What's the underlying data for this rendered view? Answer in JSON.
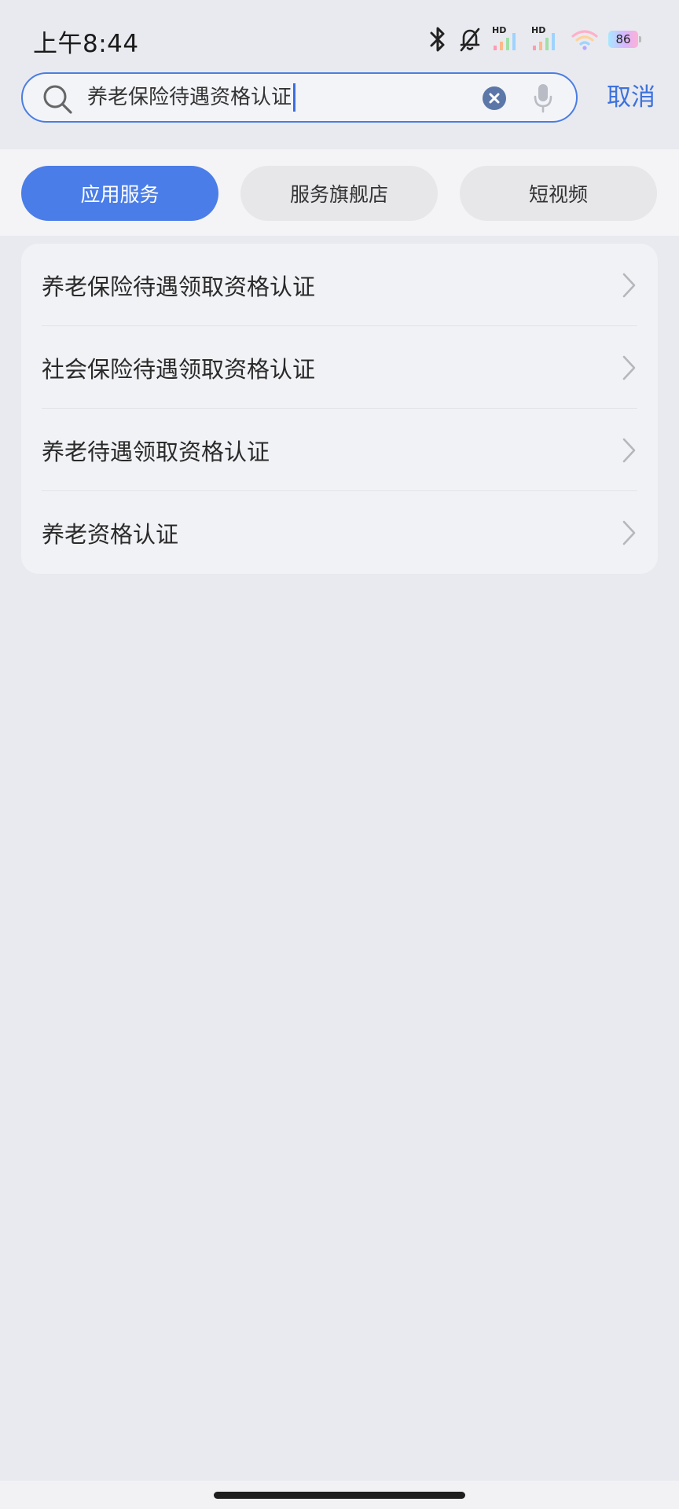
{
  "status_bar": {
    "time": "上午8:44",
    "signal_1_label": "HD",
    "signal_2_label": "HD",
    "battery": "86",
    "icons": [
      "bluetooth-icon",
      "mute-bell-icon",
      "signal-icon",
      "signal-icon",
      "wifi-icon",
      "battery-icon"
    ]
  },
  "search": {
    "query": "养老保险待遇资格认证",
    "cancel_label": "取消",
    "accent_color": "#4a7de3"
  },
  "tabs": [
    {
      "label": "应用服务",
      "active": true
    },
    {
      "label": "服务旗舰店",
      "active": false
    },
    {
      "label": "短视频",
      "active": false
    }
  ],
  "results": [
    {
      "label": "养老保险待遇领取资格认证"
    },
    {
      "label": "社会保险待遇领取资格认证"
    },
    {
      "label": "养老待遇领取资格认证"
    },
    {
      "label": "养老资格认证"
    }
  ]
}
